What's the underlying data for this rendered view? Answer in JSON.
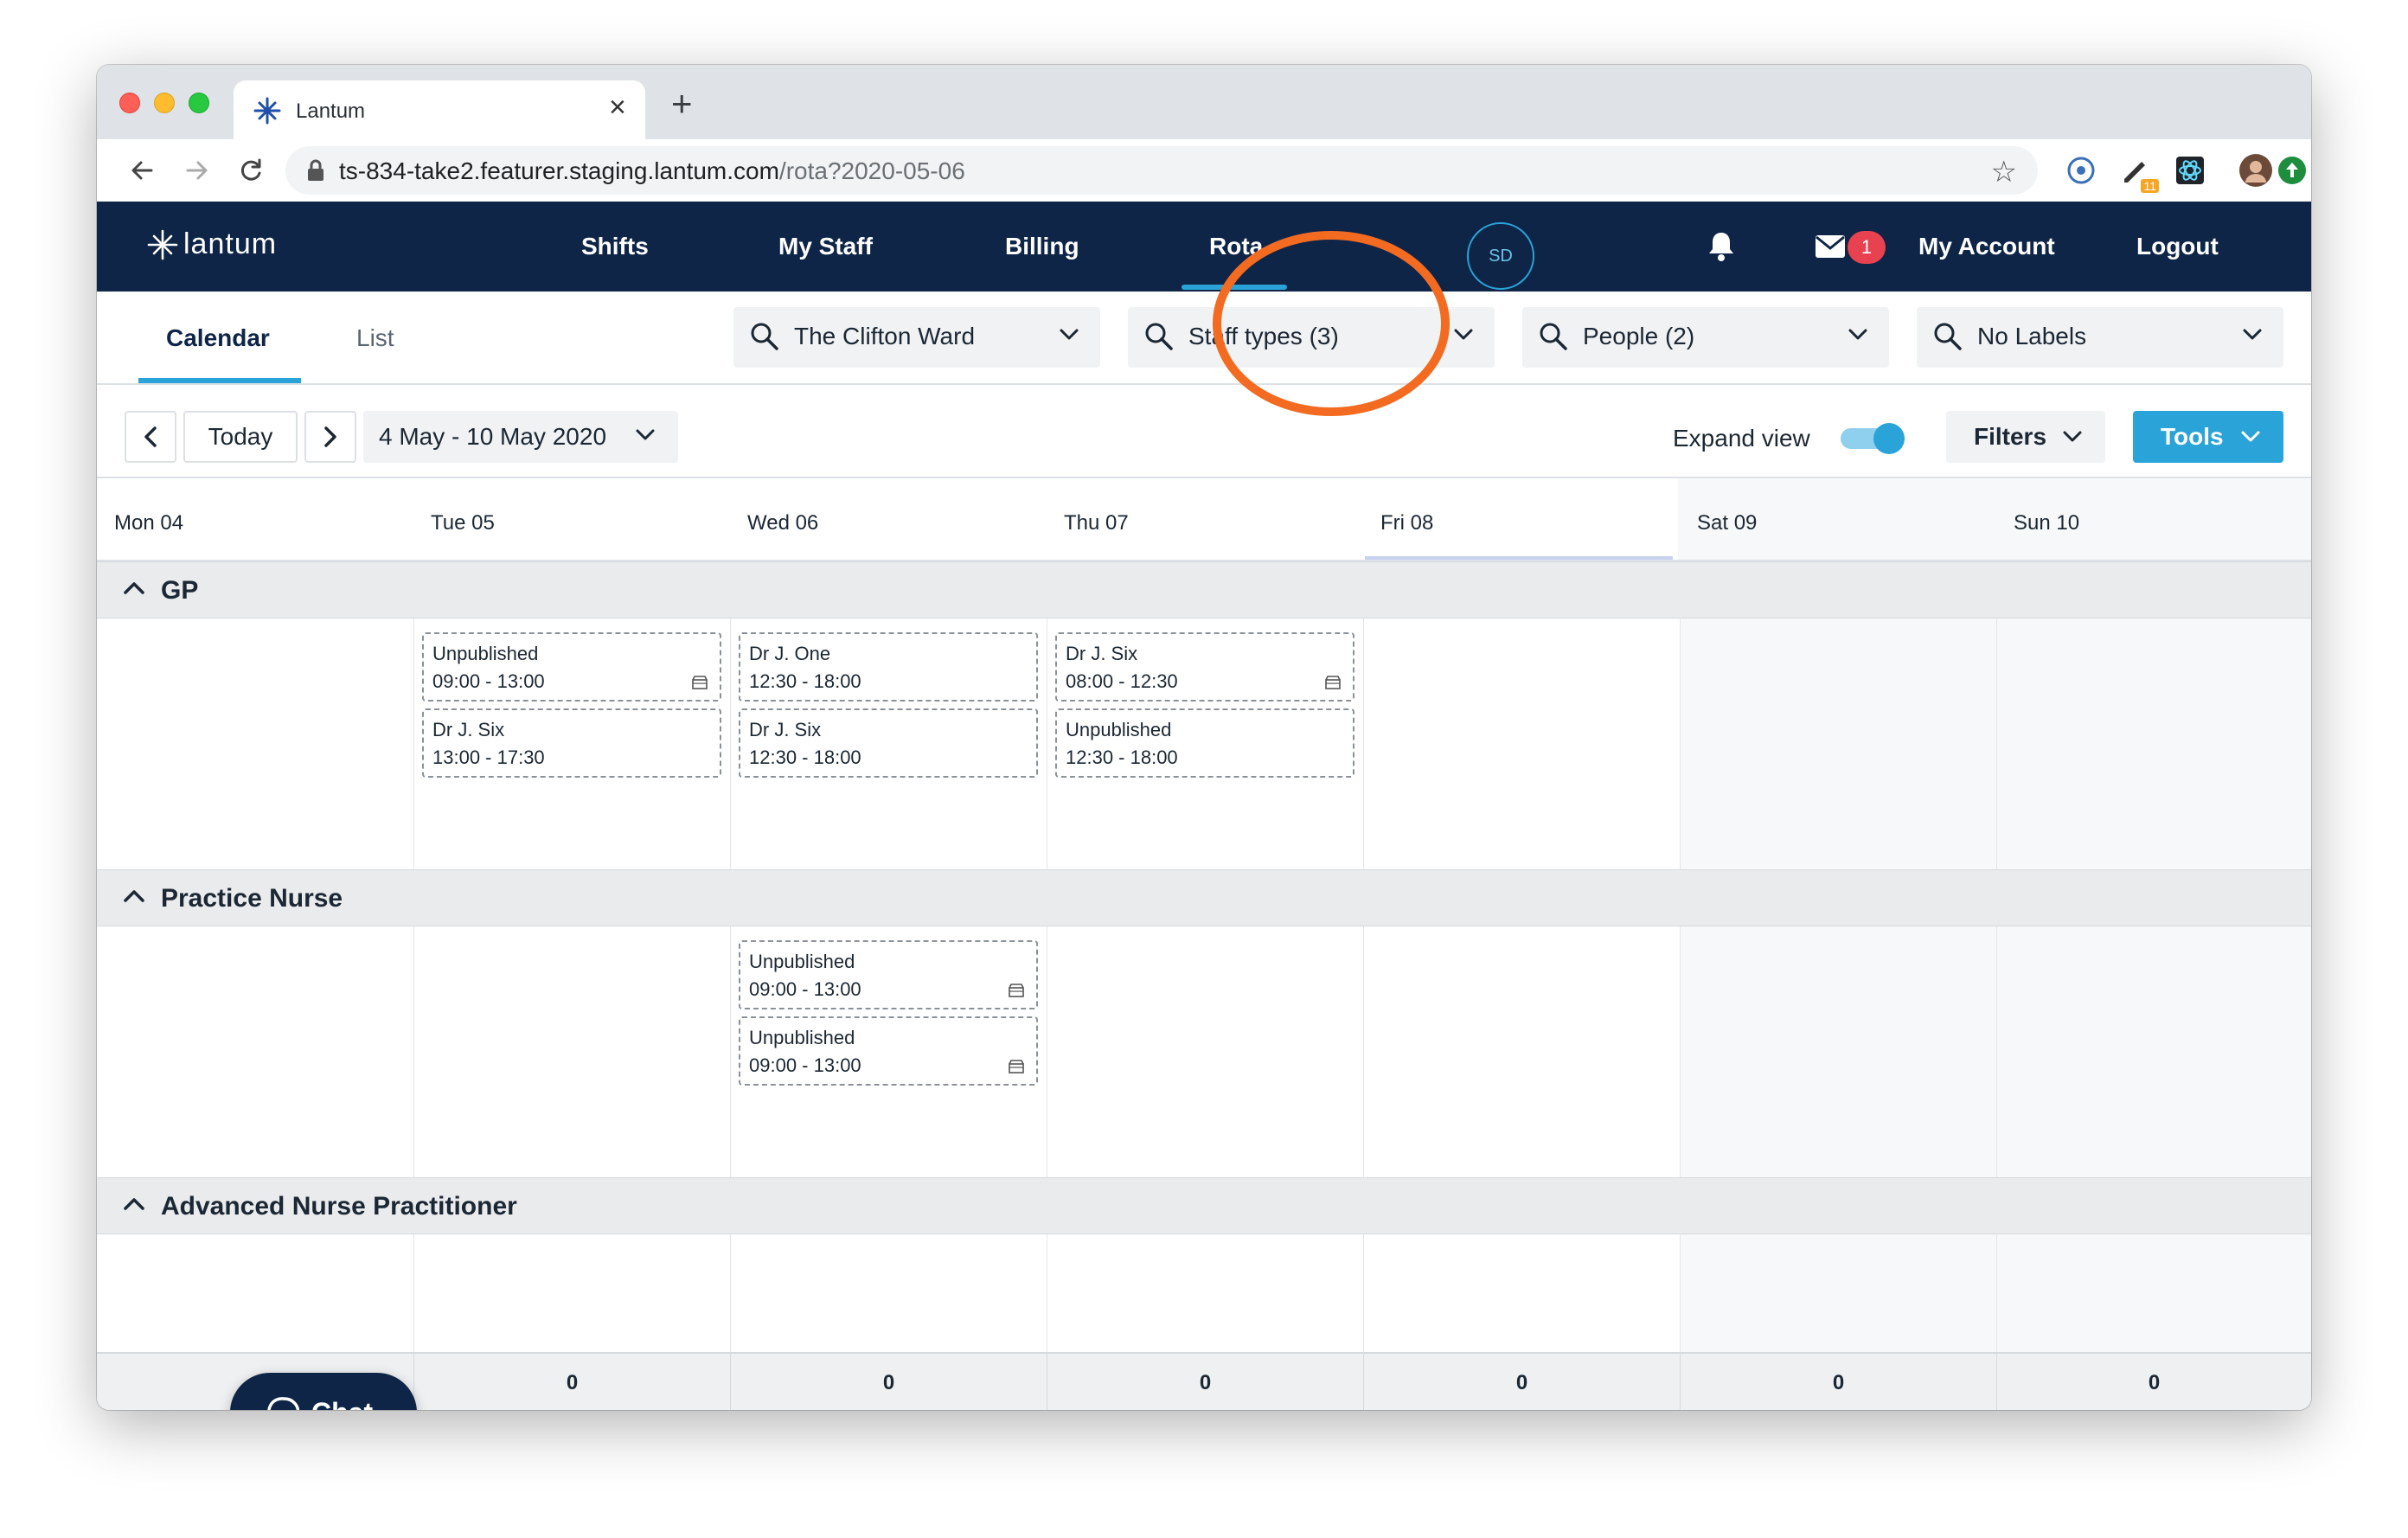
{
  "browser": {
    "tab_title": "Lantum",
    "url_host": "ts-834-take2.featurer.staging.lantum.com",
    "url_path": "/rota?2020-05-06",
    "extension_badge": "11"
  },
  "app": {
    "logo_text": "lantum",
    "nav": [
      {
        "label": "Shifts"
      },
      {
        "label": "My Staff"
      },
      {
        "label": "Billing"
      },
      {
        "label": "Rota"
      }
    ],
    "avatar_initials": "SD",
    "messages_badge": "1",
    "account_label": "My Account",
    "logout_label": "Logout"
  },
  "subnav": {
    "tabs": [
      {
        "label": "Calendar"
      },
      {
        "label": "List"
      }
    ],
    "filters": [
      {
        "value": "The Clifton Ward"
      },
      {
        "value": "Staff types (3)"
      },
      {
        "value": "People (2)"
      },
      {
        "value": "No Labels"
      }
    ]
  },
  "controls": {
    "today_label": "Today",
    "date_range": "4 May - 10 May 2020",
    "expand_view_label": "Expand view",
    "expand_view_on": true,
    "filters_label": "Filters",
    "tools_label": "Tools"
  },
  "days": [
    {
      "label": "Mon 04"
    },
    {
      "label": "Tue 05"
    },
    {
      "label": "Wed 06"
    },
    {
      "label": "Thu 07"
    },
    {
      "label": "Fri 08"
    },
    {
      "label": "Sat 09"
    },
    {
      "label": "Sun 10"
    }
  ],
  "sections": [
    {
      "name": "GP",
      "shifts": [
        {
          "day": 1,
          "slot": 0,
          "who": "Unpublished",
          "time": "09:00 - 13:00",
          "flag": true
        },
        {
          "day": 1,
          "slot": 1,
          "who": "Dr J. Six",
          "time": "13:00 - 17:30",
          "flag": false
        },
        {
          "day": 2,
          "slot": 0,
          "who": "Dr J. One",
          "time": "12:30 - 18:00",
          "flag": false
        },
        {
          "day": 2,
          "slot": 1,
          "who": "Dr J. Six",
          "time": "12:30 - 18:00",
          "flag": false
        },
        {
          "day": 3,
          "slot": 0,
          "who": "Dr J. Six",
          "time": "08:00 - 12:30",
          "flag": true
        },
        {
          "day": 3,
          "slot": 1,
          "who": "Unpublished",
          "time": "12:30 - 18:00",
          "flag": false
        }
      ]
    },
    {
      "name": "Practice Nurse",
      "shifts": [
        {
          "day": 2,
          "slot": 0,
          "who": "Unpublished",
          "time": "09:00 - 13:00",
          "flag": true
        },
        {
          "day": 2,
          "slot": 1,
          "who": "Unpublished",
          "time": "09:00 - 13:00",
          "flag": true
        }
      ]
    },
    {
      "name": "Advanced Nurse Practitioner",
      "shifts": []
    }
  ],
  "totals": [
    "0",
    "0",
    "0",
    "0",
    "0",
    "0"
  ],
  "chat_label": "Chat",
  "colors": {
    "navy": "#0e2548",
    "accent": "#2aa3d8",
    "annotation": "#f26b21",
    "badge": "#e8414f"
  }
}
